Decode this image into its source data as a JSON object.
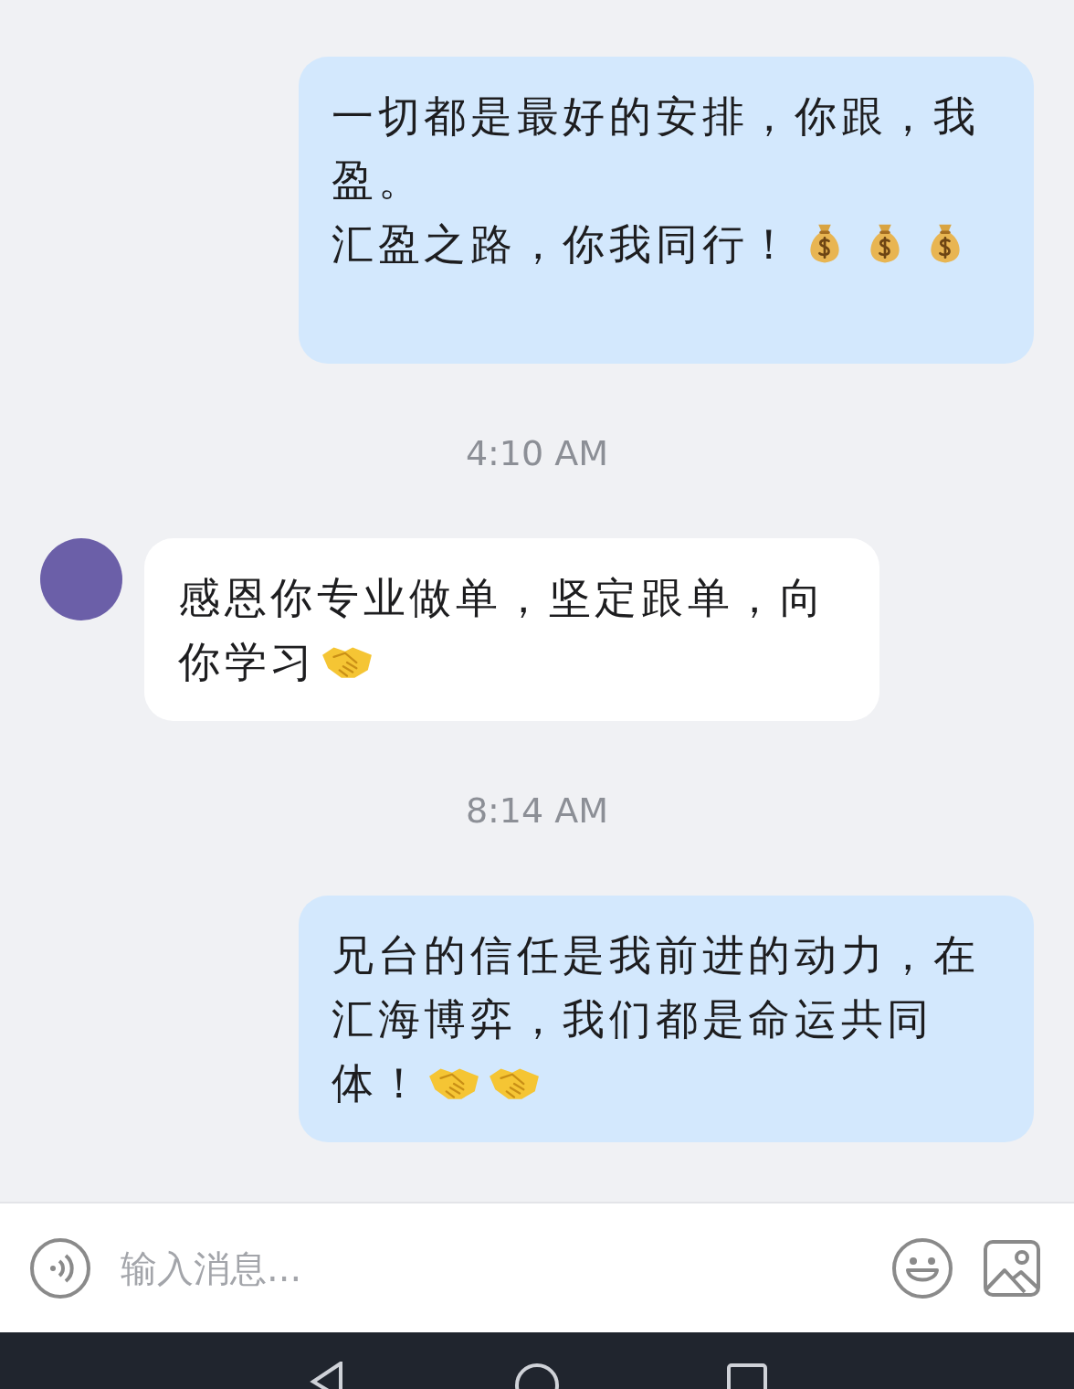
{
  "messages": [
    {
      "kind": "bubble",
      "outgoing": true,
      "paragraphs": [
        [
          {
            "kind": "text",
            "text": "一切都是最好的安排，你跟，我盈。"
          }
        ],
        [
          {
            "kind": "text",
            "text": "汇盈之路，你我同行！"
          },
          {
            "kind": "money-bag"
          },
          {
            "kind": "money-bag"
          },
          {
            "kind": "money-bag"
          }
        ]
      ]
    },
    {
      "kind": "timestamp",
      "text": "4:10 AM"
    },
    {
      "kind": "bubble",
      "outgoing": false,
      "paragraphs": [
        [
          {
            "kind": "text",
            "text": "感恩你专业做单，坚定跟单，向你学习"
          },
          {
            "kind": "handshake"
          }
        ]
      ]
    },
    {
      "kind": "timestamp",
      "text": "8:14 AM"
    },
    {
      "kind": "bubble",
      "outgoing": true,
      "paragraphs": [
        [
          {
            "kind": "text",
            "text": "兄台的信任是我前进的动力，在汇海博弈，我们都是命运共同体！"
          },
          {
            "kind": "handshake"
          },
          {
            "kind": "handshake"
          }
        ]
      ]
    }
  ],
  "composer": {
    "placeholder": "输入消息..."
  }
}
